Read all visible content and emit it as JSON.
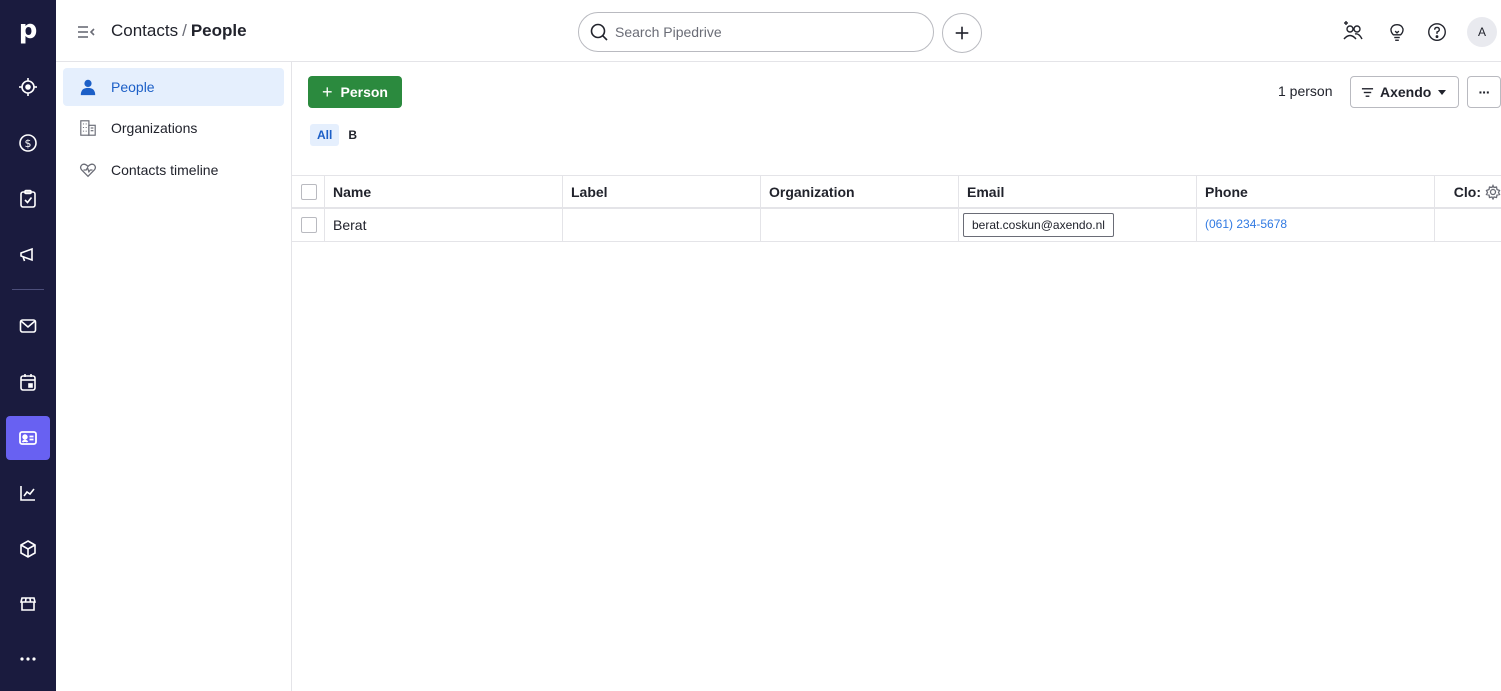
{
  "app": {
    "logo": "p",
    "rail": [
      {
        "name": "leads-icon"
      },
      {
        "name": "deals-icon"
      },
      {
        "name": "activities-icon"
      },
      {
        "name": "campaigns-icon"
      },
      {
        "name": "mail-icon"
      },
      {
        "name": "calendar-icon"
      },
      {
        "name": "contacts-icon",
        "active": true
      },
      {
        "name": "insights-icon"
      },
      {
        "name": "products-icon"
      },
      {
        "name": "marketplace-icon"
      },
      {
        "name": "more-icon"
      }
    ]
  },
  "header": {
    "breadcrumb_parent": "Contacts",
    "breadcrumb_sep": "/",
    "breadcrumb_current": "People",
    "search_placeholder": "Search Pipedrive",
    "avatar_initial": "A"
  },
  "sidebar": {
    "items": [
      {
        "label": "People",
        "icon": "person-icon",
        "active": true
      },
      {
        "label": "Organizations",
        "icon": "building-icon",
        "active": false
      },
      {
        "label": "Contacts timeline",
        "icon": "heart-pulse-icon",
        "active": false
      }
    ]
  },
  "toolbar": {
    "add_label": "Person",
    "count_label": "1 person",
    "filter_label": "Axendo",
    "more_label": "···"
  },
  "alpha_filter": [
    "All",
    "B"
  ],
  "table": {
    "columns": [
      "Name",
      "Label",
      "Organization",
      "Email",
      "Phone",
      "Clo:"
    ],
    "rows": [
      {
        "name": "Berat",
        "label": "",
        "organization": "",
        "email": "berat.coskun@axendo.nl",
        "phone": "(061) 234-5678",
        "closed": ""
      }
    ]
  },
  "colors": {
    "rail_bg": "#1a1b3e",
    "accent": "#6861f2",
    "primary_green": "#2b8a3e",
    "link_blue": "#317ae2",
    "active_bg": "#e5effd"
  }
}
